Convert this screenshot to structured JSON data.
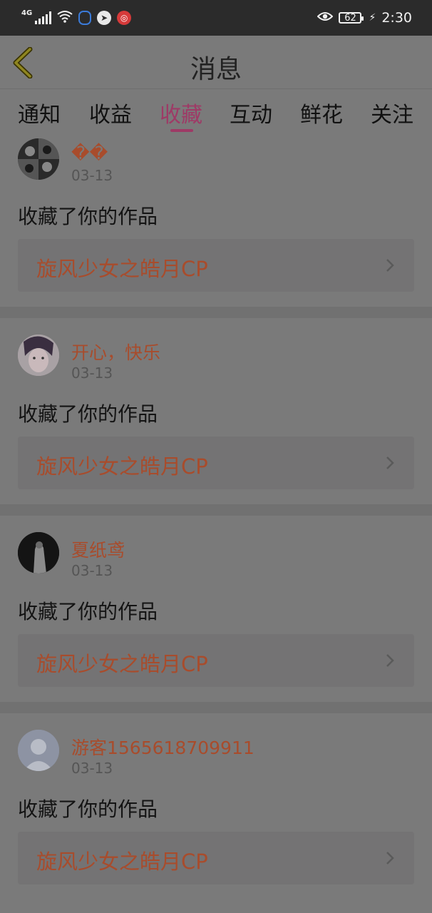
{
  "status_bar": {
    "network": "4G",
    "battery": "62",
    "time": "2:30",
    "icons": [
      "signal-icon",
      "wifi-icon",
      "app-icon-1",
      "app-icon-2",
      "app-icon-3",
      "eye-icon",
      "charging-icon"
    ]
  },
  "header": {
    "title": "消息",
    "back_icon": "chevron-left-icon"
  },
  "tabs": [
    {
      "label": "通知"
    },
    {
      "label": "收益"
    },
    {
      "label": "收藏",
      "active": true
    },
    {
      "label": "互动"
    },
    {
      "label": "鲜花"
    },
    {
      "label": "关注"
    }
  ],
  "items": [
    {
      "user": "��",
      "date": "03-13",
      "action": "收藏了你的作品",
      "work": "旋风少女之皓月CP"
    },
    {
      "user": "开心，快乐",
      "date": "03-13",
      "action": "收藏了你的作品",
      "work": "旋风少女之皓月CP"
    },
    {
      "user": "夏纸鸢",
      "date": "03-13",
      "action": "收藏了你的作品",
      "work": "旋风少女之皓月CP"
    },
    {
      "user": "游客1565618709911",
      "date": "03-13",
      "action": "收藏了你的作品",
      "work": "旋风少女之皓月CP"
    }
  ],
  "colors": {
    "background": "#7a7a7a",
    "accent": "#9e3a66",
    "username": "#a84c2c",
    "status_bar": "#2b2b2b"
  }
}
